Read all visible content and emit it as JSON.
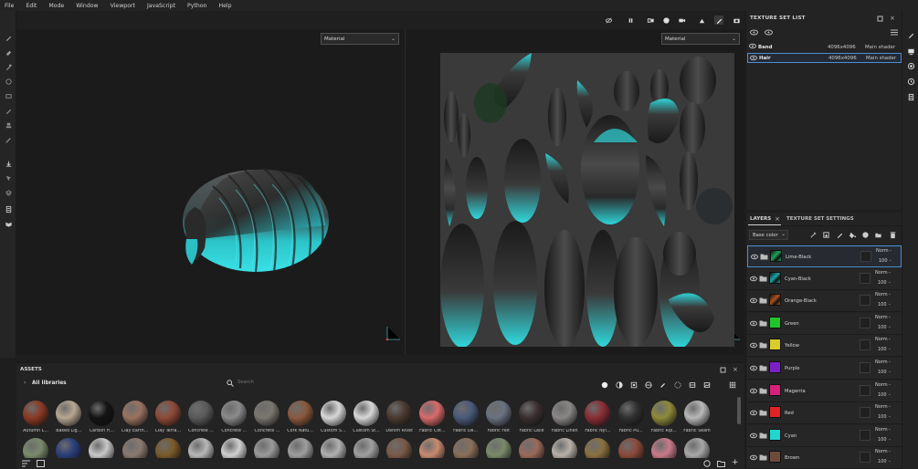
{
  "menu": [
    "File",
    "Edit",
    "Mode",
    "Window",
    "Viewport",
    "JavaScript",
    "Python",
    "Help"
  ],
  "viewport": {
    "left_material": "Material",
    "right_material": "Material"
  },
  "texture_set_list": {
    "title": "TEXTURE SET LIST",
    "rows": [
      {
        "name": "Band",
        "resolution": "4096x4096",
        "shader": "Main shader",
        "selected": false
      },
      {
        "name": "Hair",
        "resolution": "4096x4096",
        "shader": "Main shader",
        "selected": true
      }
    ]
  },
  "layers_panel": {
    "tab_layers": "LAYERS",
    "tab_settings": "TEXTURE SET SETTINGS",
    "channel": "Base color",
    "layers": [
      {
        "name": "Lime-Black",
        "color": "#1fa35a",
        "type": "folder",
        "blend": "Norm",
        "opacity": "100",
        "selected": true
      },
      {
        "name": "Cyan-Black",
        "color": "#1aa6a6",
        "type": "folder",
        "blend": "Norm",
        "opacity": "100",
        "selected": false
      },
      {
        "name": "Orange-Black",
        "color": "#b0501e",
        "type": "folder",
        "blend": "Norm",
        "opacity": "100",
        "selected": false
      },
      {
        "name": "Green",
        "color": "#21c52b",
        "type": "fill",
        "blend": "Norm",
        "opacity": "100",
        "selected": false
      },
      {
        "name": "Yellow",
        "color": "#d9cc2a",
        "type": "fill",
        "blend": "Norm",
        "opacity": "100",
        "selected": false
      },
      {
        "name": "Purple",
        "color": "#7b1fc7",
        "type": "fill",
        "blend": "Norm",
        "opacity": "100",
        "selected": false
      },
      {
        "name": "Magenta",
        "color": "#d6207a",
        "type": "fill",
        "blend": "Norm",
        "opacity": "100",
        "selected": false
      },
      {
        "name": "Red",
        "color": "#e02424",
        "type": "fill",
        "blend": "Norm",
        "opacity": "100",
        "selected": false
      },
      {
        "name": "Cyan",
        "color": "#1fd6d0",
        "type": "fill",
        "blend": "Norm",
        "opacity": "100",
        "selected": false
      },
      {
        "name": "Brown",
        "color": "#6e4a3a",
        "type": "fill",
        "blend": "Norm",
        "opacity": "100",
        "selected": false
      }
    ]
  },
  "assets": {
    "title": "ASSETS",
    "library": "All libraries",
    "search_placeholder": "Search",
    "materials_row1": [
      {
        "label": "Autumn L...",
        "color": "#8a3a24"
      },
      {
        "label": "Baked Lig...",
        "color": "#b8a792"
      },
      {
        "label": "Carbon Fi...",
        "color": "#141414"
      },
      {
        "label": "Clay Earth...",
        "color": "#9a7260"
      },
      {
        "label": "Clay Terra...",
        "color": "#8e4a38"
      },
      {
        "label": "Concrete ...",
        "color": "#5a5a5a"
      },
      {
        "label": "Concrete ...",
        "color": "#8a8a8a"
      },
      {
        "label": "Concrete ...",
        "color": "#7a7670"
      },
      {
        "label": "Cork Natu...",
        "color": "#8a5a3e"
      },
      {
        "label": "Custom S...",
        "color": "#d8d8d8"
      },
      {
        "label": "Custom St...",
        "color": "#d8d8d8"
      },
      {
        "label": "Denim Rivet",
        "color": "#4a3a30"
      },
      {
        "label": "Fabric Cot...",
        "color": "#d86a6a"
      },
      {
        "label": "Fabric De...",
        "color": "#4a5a7a"
      },
      {
        "label": "Fabric Felt",
        "color": "#6a7280"
      },
      {
        "label": "Fabric Lace",
        "color": "#3a3030"
      },
      {
        "label": "Fabric Linen",
        "color": "#8a8686"
      },
      {
        "label": "Fabric Nyl...",
        "color": "#8a2e36"
      },
      {
        "label": "Fabric Pu...",
        "color": "#303030"
      },
      {
        "label": "Fabric Rip...",
        "color": "#8e8a3a"
      },
      {
        "label": "Fabric Seam",
        "color": "#b8b8b8"
      }
    ],
    "materials_row2": [
      "#7a8a6a",
      "#2a3e7a",
      "#c8c8c8",
      "#8a7a70",
      "#7a5a2a",
      "#b8b8b8",
      "#d0d0d0",
      "#9a9a9a",
      "#9e9e9e",
      "#b0b0b0",
      "#a0a0a0",
      "#7a5a48",
      "#c88a70",
      "#8a6e5a",
      "#7a8a6a",
      "#9a6a5a",
      "#b8b0a8",
      "#8a7040",
      "#8a4a3a",
      "#c87a8a",
      "#a8a8a8"
    ]
  }
}
